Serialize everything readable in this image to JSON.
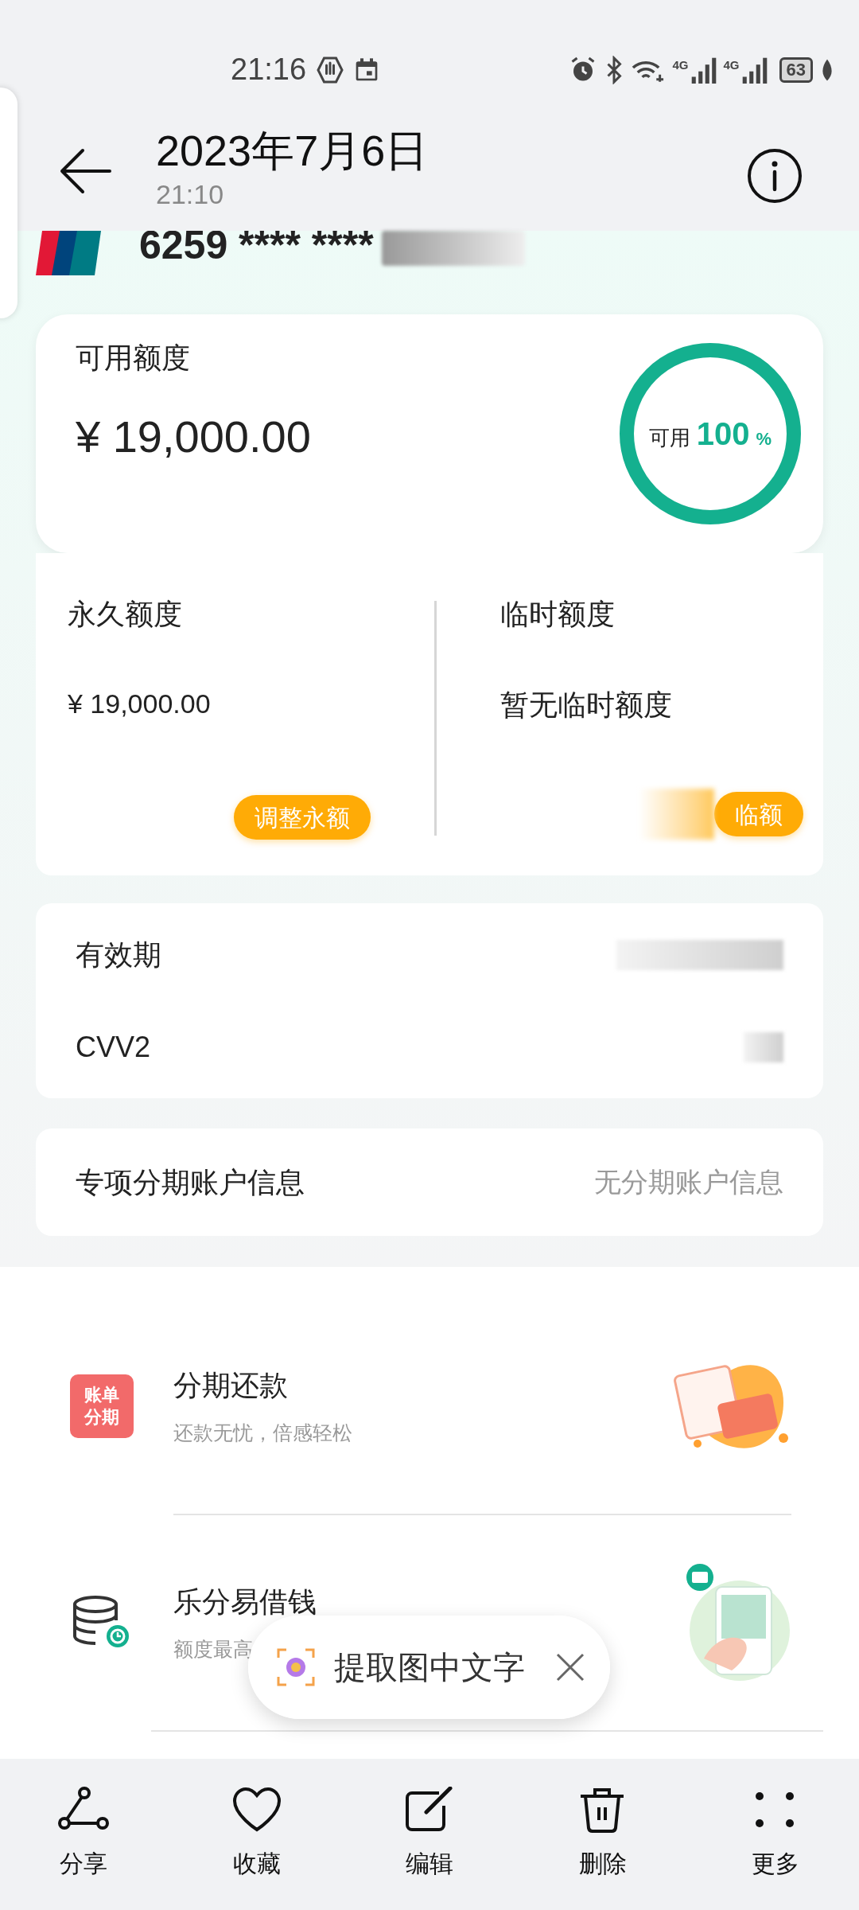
{
  "status_bar": {
    "time": "21:16",
    "network_1": "4G",
    "network_2": "4G",
    "battery": "63"
  },
  "header": {
    "title": "2023年7月6日",
    "subtitle": "21:10"
  },
  "card": {
    "number": "6259 **** ****"
  },
  "available": {
    "label": "可用额度",
    "amount": "¥ 19,000.00",
    "ring_label": "可用",
    "ring_value": "100",
    "ring_unit": "%",
    "level": 1
  },
  "limits": [
    {
      "label": "永久额度",
      "value": "¥ 19,000.00",
      "button": "调整永额",
      "blurred": false
    },
    {
      "label": "临时额度",
      "value": "暂无临时额度",
      "button": "临额",
      "blurred": true
    }
  ],
  "card_info": [
    {
      "label": "有效期"
    },
    {
      "label": "CVV2"
    }
  ],
  "installment": {
    "label": "专项分期账户信息",
    "value": "无分期账户信息"
  },
  "services": [
    {
      "kind": "bill",
      "icon_text": [
        "账单",
        "分期"
      ],
      "title": "分期还款",
      "subtitle": "还款无忧，倍感轻松"
    },
    {
      "kind": "loan",
      "title": "乐分易借钱",
      "subtitle": "额度最高"
    }
  ],
  "popup": {
    "text": "提取图中文字"
  },
  "toolbar": [
    {
      "kind": "share",
      "label": "分享"
    },
    {
      "kind": "favorite",
      "label": "收藏"
    },
    {
      "kind": "edit",
      "label": "编辑"
    },
    {
      "kind": "delete",
      "label": "删除"
    },
    {
      "kind": "more",
      "label": "更多"
    }
  ]
}
